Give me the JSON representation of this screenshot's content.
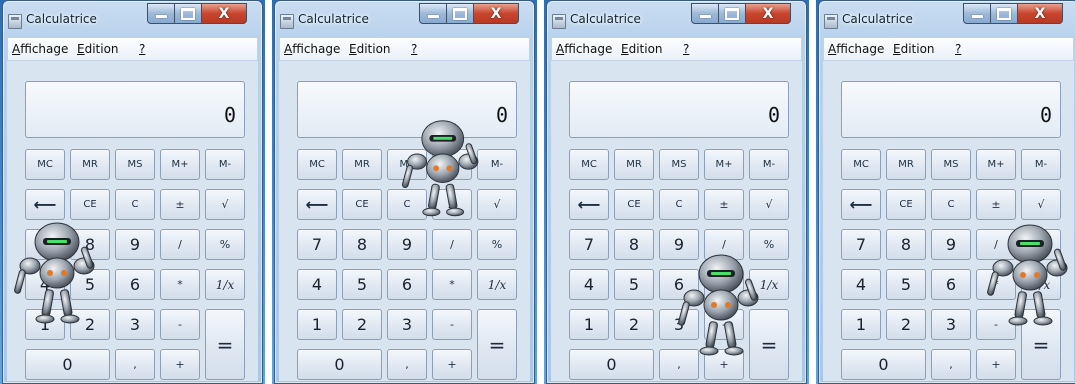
{
  "windows": [
    {
      "title": "Calculatrice",
      "display": "0"
    },
    {
      "title": "Calculatrice",
      "display": "0"
    },
    {
      "title": "Calculatrice",
      "display": "0"
    },
    {
      "title": "Calculatrice",
      "display": "0"
    }
  ],
  "menu": {
    "view": "Affichage",
    "edit": "Edition",
    "help": "?"
  },
  "window_buttons": {
    "minimize": "—",
    "maximize": "□",
    "close": "X"
  },
  "keys": {
    "mc": "MC",
    "mr": "MR",
    "ms": "MS",
    "mplus": "M+",
    "mminus": "M-",
    "back": "⟵",
    "ce": "CE",
    "c": "C",
    "plusminus": "±",
    "sqrt": "√",
    "k7": "7",
    "k8": "8",
    "k9": "9",
    "div": "/",
    "pct": "%",
    "k4": "4",
    "k5": "5",
    "k6": "6",
    "mul": "*",
    "inv": "1/x",
    "k1": "1",
    "k2": "2",
    "k3": "3",
    "sub": "-",
    "eq": "=",
    "k0": "0",
    "dot": ",",
    "add": "+"
  },
  "colors": {
    "desktop": "#3a86cf",
    "close_red": "#c9452e",
    "robot_metal": "#9aa3ad"
  },
  "icons": [
    "calculator-icon",
    "robot-icon"
  ]
}
